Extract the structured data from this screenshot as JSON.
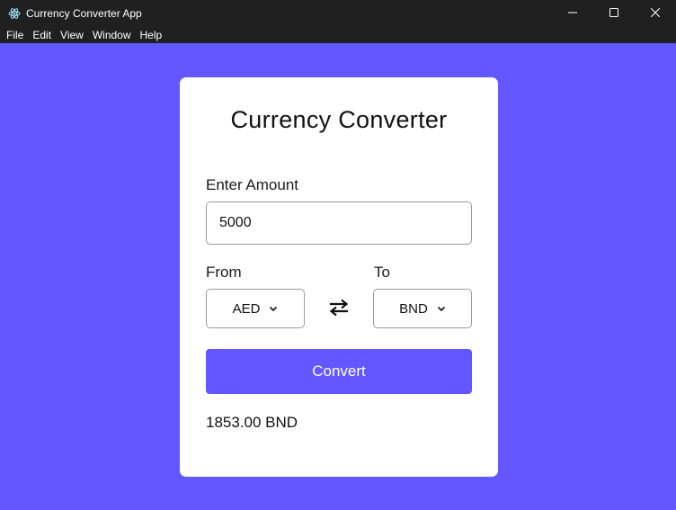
{
  "window": {
    "title": "Currency Converter App",
    "icon": "electron-logo-icon",
    "controls": [
      "minimize-icon",
      "maximize-icon",
      "close-icon"
    ]
  },
  "menu": {
    "items": [
      "File",
      "Edit",
      "View",
      "Window",
      "Help"
    ]
  },
  "converter": {
    "title": "Currency Converter",
    "amount_label": "Enter Amount",
    "amount_value": "5000",
    "from_label": "From",
    "to_label": "To",
    "from_currency": "AED",
    "to_currency": "BND",
    "swap_icon": "swap-arrows-icon",
    "convert_label": "Convert",
    "result": "1853.00 BND"
  },
  "colors": {
    "accent": "#6358ff",
    "titlebar": "#202020",
    "card": "#ffffff"
  }
}
